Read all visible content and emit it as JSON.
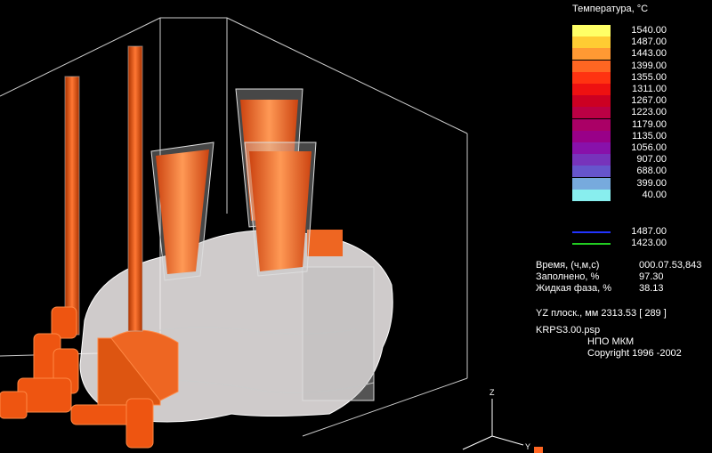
{
  "legend": {
    "title": "Температура, °C",
    "entries": [
      {
        "value": "1540.00",
        "color": "#ffff66"
      },
      {
        "value": "1487.00",
        "color": "#ffcc33"
      },
      {
        "value": "1443.00",
        "color": "#ff9933"
      },
      {
        "value": "1399.00",
        "color": "#ff6622"
      },
      {
        "value": "1355.00",
        "color": "#ff3311"
      },
      {
        "value": "1311.00",
        "color": "#ee1111"
      },
      {
        "value": "1267.00",
        "color": "#cc0022"
      },
      {
        "value": "1223.00",
        "color": "#bb0044"
      },
      {
        "value": "1179.00",
        "color": "#aa0066"
      },
      {
        "value": "1135.00",
        "color": "#990088"
      },
      {
        "value": "1056.00",
        "color": "#8811aa"
      },
      {
        "value": "907.00",
        "color": "#7733bb"
      },
      {
        "value": "688.00",
        "color": "#6655cc"
      },
      {
        "value": "399.00",
        "color": "#77aadd"
      },
      {
        "value": "40.00",
        "color": "#88eeee"
      }
    ],
    "lines": [
      {
        "value": "1487.00",
        "color": "#2233ff"
      },
      {
        "value": "1423.00",
        "color": "#22cc22"
      }
    ]
  },
  "info": {
    "time_label": "Время, (ч,м,с)",
    "time_value": "000.07.53,843",
    "filled_label": "Заполнено, %",
    "filled_value": "97.30",
    "liquid_label": "Жидкая фаза, %",
    "liquid_value": "38.13",
    "plane": "YZ плоск., мм  2313.53   [ 289 ]",
    "file": "KRPS3.00.psp",
    "org": "НПО МКМ",
    "copyright": "Copyright 1996 -2002"
  },
  "axes": {
    "z": "Z",
    "y": "Y"
  }
}
